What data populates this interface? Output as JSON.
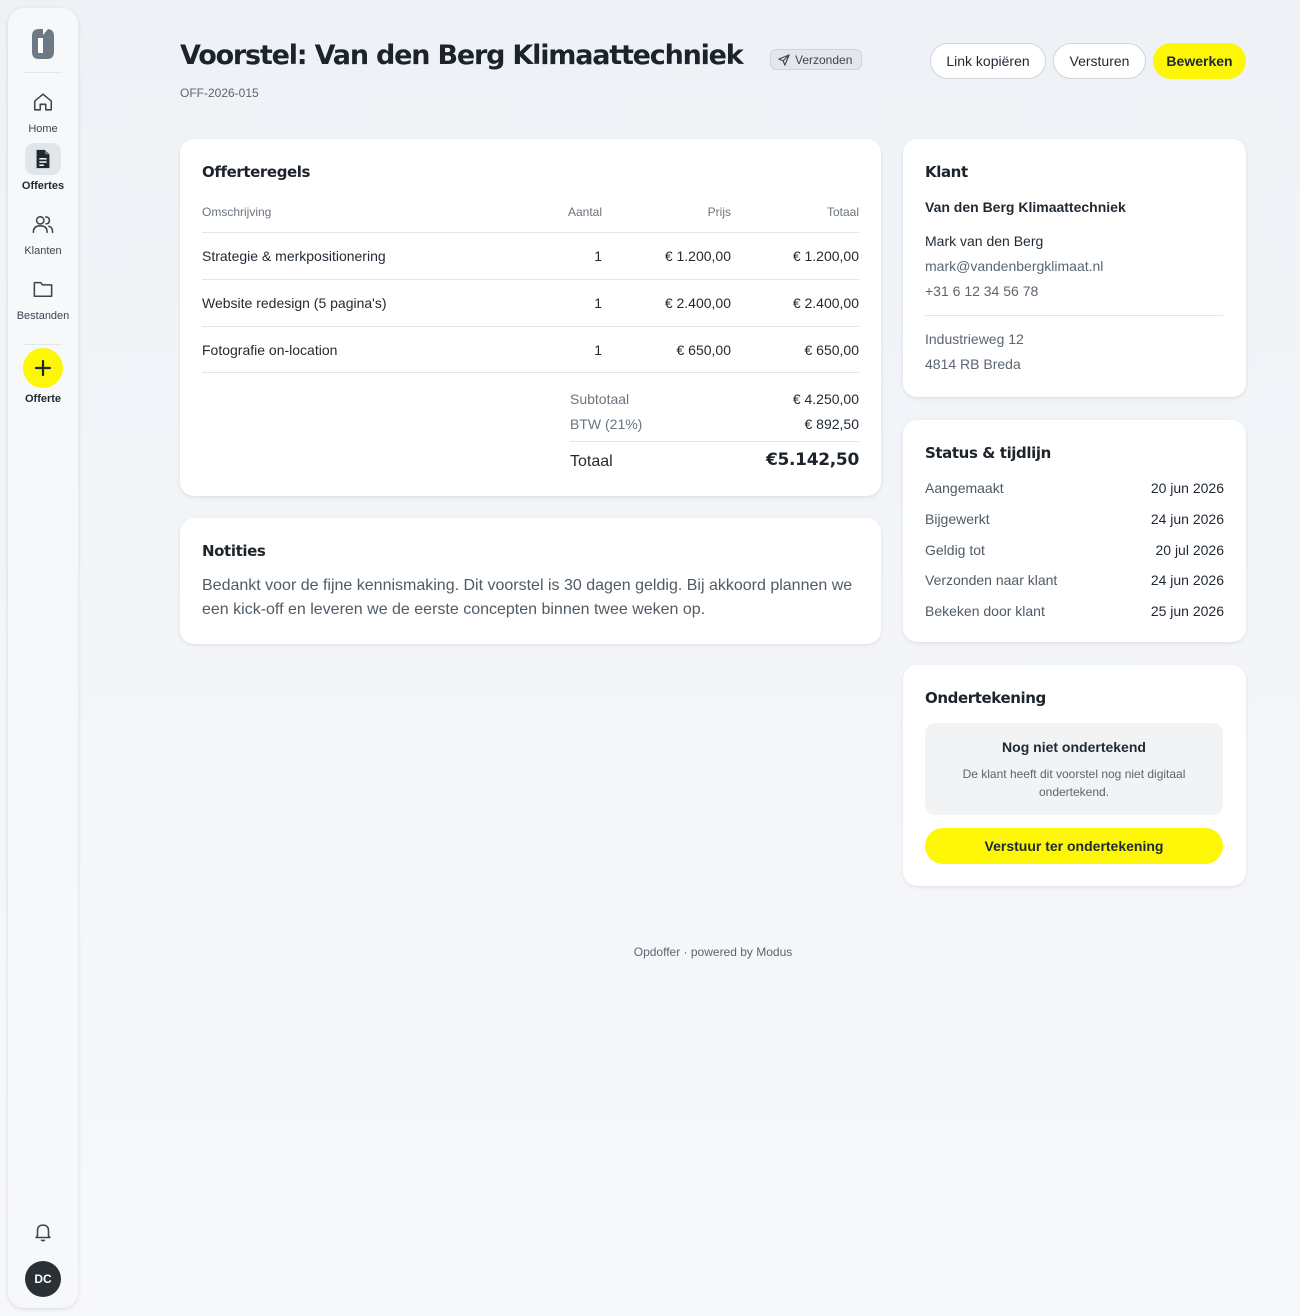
{
  "colors": {
    "accent": "#fdf604",
    "text": "#1f2933",
    "muted": "#6a757f",
    "background": "#eef2f6"
  },
  "sidebar": {
    "logo_icon": "brand-logo-icon",
    "items": [
      {
        "label": "Home",
        "icon": "home-icon",
        "active": false
      },
      {
        "label": "Offertes",
        "icon": "document-icon",
        "active": true
      },
      {
        "label": "Klanten",
        "icon": "users-icon",
        "active": false
      },
      {
        "label": "Bestanden",
        "icon": "folder-icon",
        "active": false
      }
    ],
    "new_label": "Offerte",
    "new_icon": "plus-icon",
    "bell_icon": "bell-icon",
    "avatar_initials": "DC"
  },
  "header": {
    "title": "Voorstel: Van den Berg Klimaattechniek",
    "status": "Verzonden",
    "status_icon": "send-icon",
    "reference": "OFF-2026-015",
    "actions": {
      "copy_link": "Link kopiëren",
      "send": "Versturen",
      "edit": "Bewerken"
    }
  },
  "lines": {
    "title": "Offerteregels",
    "columns": {
      "description": "Omschrijving",
      "quantity": "Aantal",
      "price": "Prijs",
      "total": "Totaal"
    },
    "rows": [
      {
        "description": "Strategie & merkpositionering",
        "quantity": "1",
        "price": "€ 1.200,00",
        "total": "€ 1.200,00"
      },
      {
        "description": "Website redesign (5 pagina's)",
        "quantity": "1",
        "price": "€ 2.400,00",
        "total": "€ 2.400,00"
      },
      {
        "description": "Fotografie on-location",
        "quantity": "1",
        "price": "€ 650,00",
        "total": "€ 650,00"
      }
    ],
    "subtotal_label": "Subtotaal",
    "subtotal_value": "€ 4.250,00",
    "vat_label": "BTW (21%)",
    "vat_value": "€ 892,50",
    "total_label": "Totaal",
    "total_value": "€5.142,50"
  },
  "notes": {
    "title": "Notities",
    "text": "Bedankt voor de fijne kennismaking. Dit voorstel is 30 dagen geldig. Bij akkoord plannen we een kick-off en leveren we de eerste concepten binnen twee weken op."
  },
  "client": {
    "title": "Klant",
    "company": "Van den Berg Klimaattechniek",
    "contact_name": "Mark van den Berg",
    "email": "mark@vandenbergklimaat.nl",
    "phone": "+31 6 12 34 56 78",
    "street": "Industrieweg 12",
    "city": "4814 RB Breda"
  },
  "timeline": {
    "title": "Status & tijdlijn",
    "events": [
      {
        "label": "Aangemaakt",
        "date": "20 jun 2026"
      },
      {
        "label": "Bijgewerkt",
        "date": "24 jun 2026"
      },
      {
        "label": "Geldig tot",
        "date": "20 jul 2026"
      },
      {
        "label": "Verzonden naar klant",
        "date": "24 jun 2026"
      },
      {
        "label": "Bekeken door klant",
        "date": "25 jun 2026"
      }
    ]
  },
  "signature": {
    "title": "Ondertekening",
    "status_title": "Nog niet ondertekend",
    "status_text": "De klant heeft dit voorstel nog niet digitaal ondertekend.",
    "button": "Verstuur ter ondertekening"
  },
  "footer": {
    "text": "Opdoffer · powered by Modus"
  }
}
